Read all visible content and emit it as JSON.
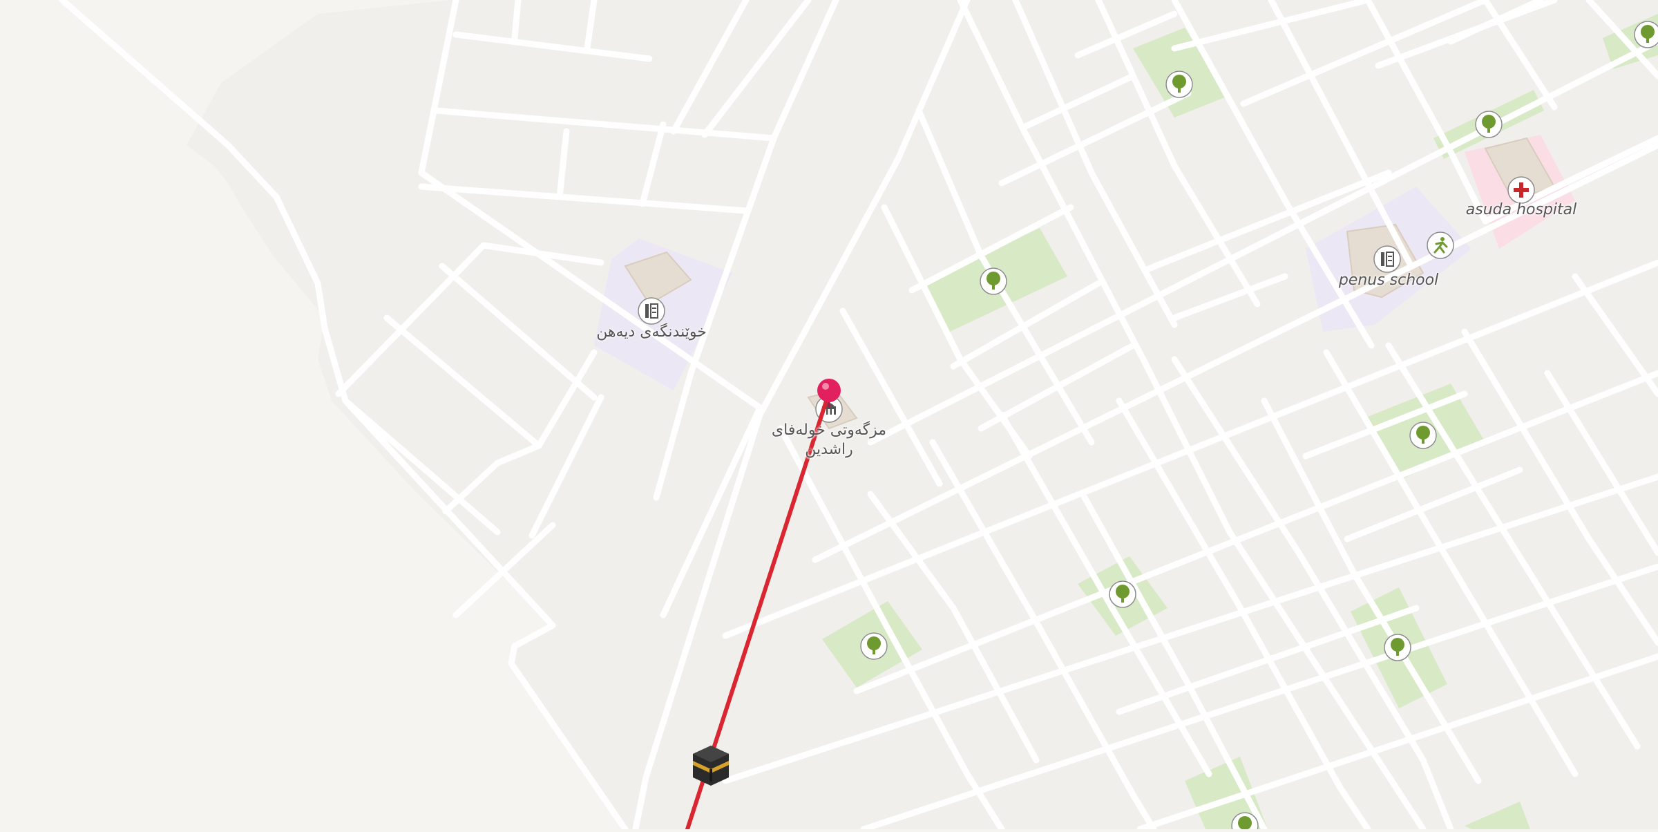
{
  "map": {
    "colors": {
      "desert": "#f6f4f1",
      "urban": "#f1efec",
      "road": "#ffffff",
      "park": "#d8e9c6",
      "park_tree": "#6f9a2f",
      "school_area": "#ece7f5",
      "hospital_area": "#fbdde6",
      "building": "#e6ddd2",
      "route": "#d92631",
      "pin": "#e3205f"
    },
    "places": [
      {
        "name": "خوێندنگەی دیەهن",
        "kind": "school"
      },
      {
        "name": "مزگەوتی خولەفای راشدین",
        "kind": "mosque"
      },
      {
        "name": "penus school",
        "kind": "school"
      },
      {
        "name": "asuda hospital",
        "kind": "hospital"
      }
    ],
    "icons": [
      "school-icon",
      "mosque-icon",
      "sports-icon",
      "hospital-icon",
      "tree-icon",
      "kaaba-icon",
      "location-pin-icon"
    ],
    "route": {
      "label": "qibla direction",
      "color": "#d92631"
    }
  }
}
